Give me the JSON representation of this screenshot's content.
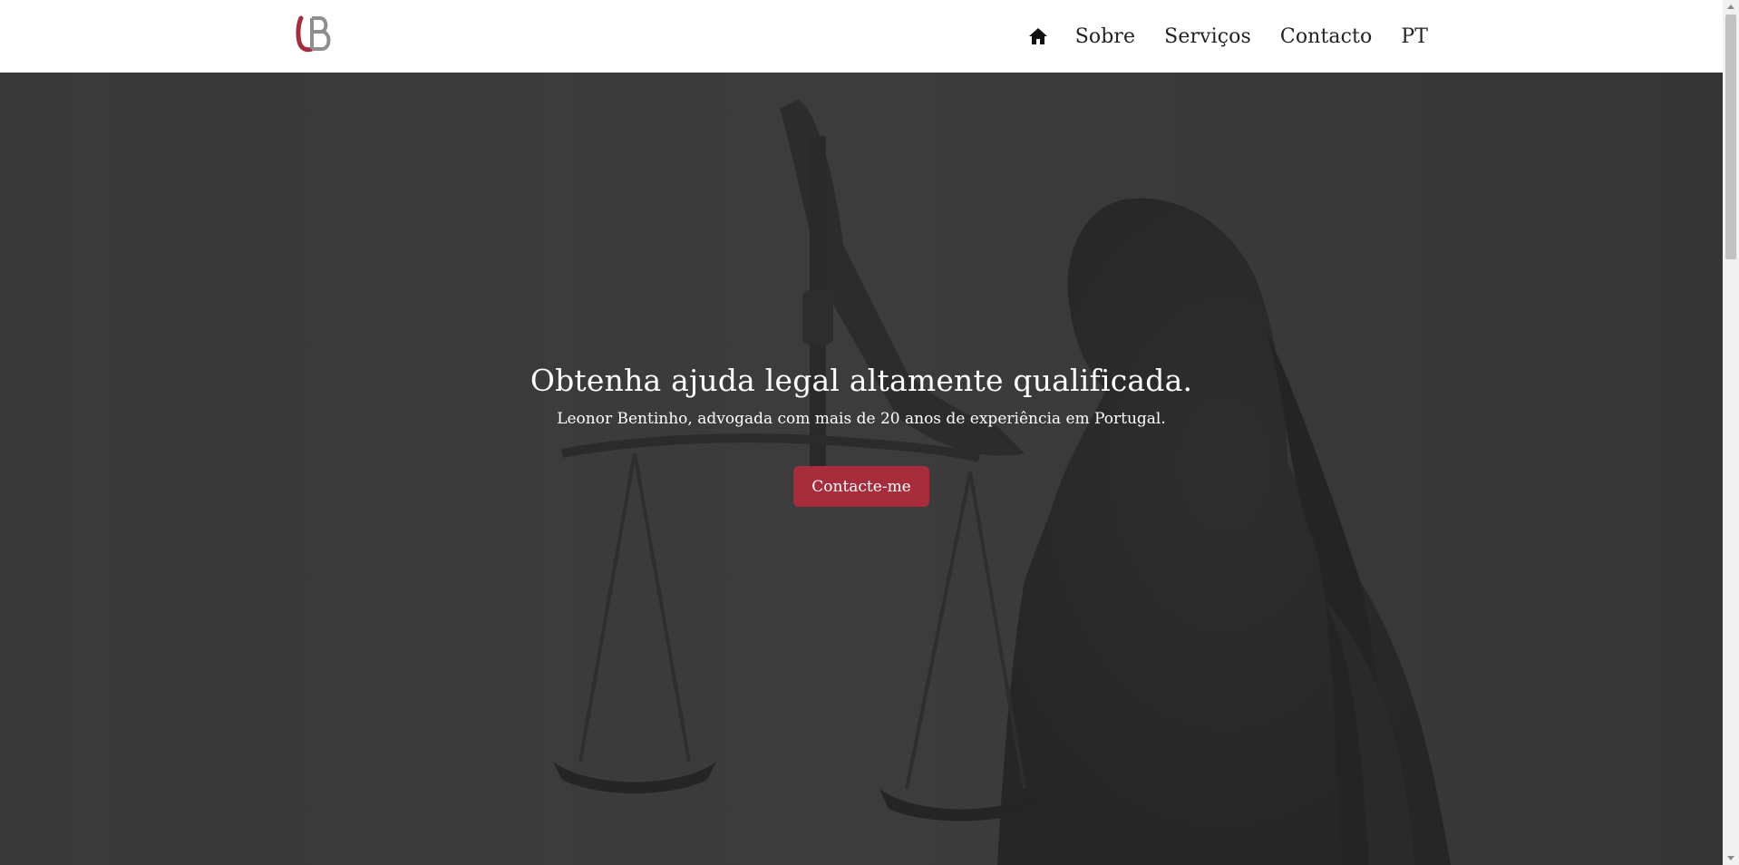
{
  "brand": {
    "logo_icon": "lb-monogram-logo",
    "colors": {
      "accent": "#a72d3d",
      "logo_gray": "#8e8e8e"
    }
  },
  "nav": {
    "home_icon": "home-icon",
    "items": [
      {
        "label": "Sobre"
      },
      {
        "label": "Serviços"
      },
      {
        "label": "Contacto"
      },
      {
        "label": "PT"
      }
    ]
  },
  "hero": {
    "headline": "Obtenha ajuda legal altamente qualificada.",
    "subhead": "Leonor Bentinho, advogada com mais de 20 anos de experiência em Portugal.",
    "cta_label": "Contacte-me",
    "background_icon": "lady-justice-statue-image"
  }
}
